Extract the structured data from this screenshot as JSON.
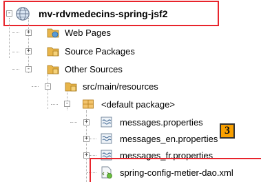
{
  "tree": {
    "nodes": [
      {
        "label": "mv-rdvmedecins-spring-jsf2",
        "icon": "project-globe-icon",
        "toggle": "-"
      },
      {
        "label": "Web Pages",
        "icon": "web-pages-folder-icon",
        "toggle": "+"
      },
      {
        "label": "Source Packages",
        "icon": "source-packages-folder-icon",
        "toggle": "+"
      },
      {
        "label": "Other Sources",
        "icon": "other-sources-folder-icon",
        "toggle": "-"
      },
      {
        "label": "src/main/resources",
        "icon": "resources-folder-icon",
        "toggle": "-"
      },
      {
        "label": "<default package>",
        "icon": "package-icon",
        "toggle": "-"
      },
      {
        "label": "messages.properties",
        "icon": "properties-file-icon",
        "toggle": "+"
      },
      {
        "label": "messages_en.properties",
        "icon": "properties-file-icon",
        "toggle": "+"
      },
      {
        "label": "messages_fr.properties",
        "icon": "properties-file-icon",
        "toggle": "+"
      },
      {
        "label": "spring-config-metier-dao.xml",
        "icon": "xml-file-icon",
        "toggle": ""
      }
    ]
  },
  "annotations": {
    "callout_number": "3",
    "highlight_color": "#e8242c",
    "callout_color": "#f9a000"
  }
}
